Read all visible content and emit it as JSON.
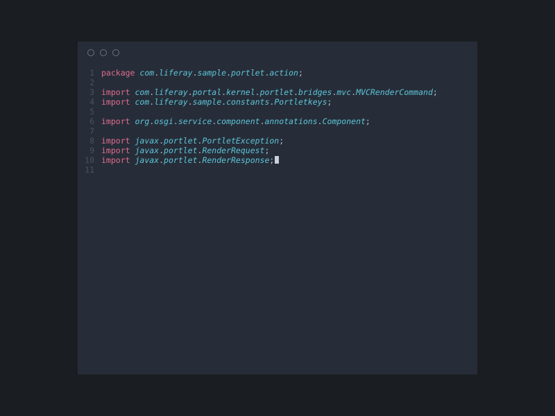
{
  "editor": {
    "lines": [
      {
        "num": "1",
        "tokens": [
          {
            "t": "kw",
            "v": "package"
          },
          {
            "t": "sp",
            "v": " "
          },
          {
            "t": "pkg",
            "v": "com"
          },
          {
            "t": "punct",
            "v": "."
          },
          {
            "t": "pkg",
            "v": "liferay"
          },
          {
            "t": "punct",
            "v": "."
          },
          {
            "t": "pkg",
            "v": "sample"
          },
          {
            "t": "punct",
            "v": "."
          },
          {
            "t": "pkg",
            "v": "portlet"
          },
          {
            "t": "punct",
            "v": "."
          },
          {
            "t": "pkg",
            "v": "action"
          },
          {
            "t": "punct",
            "v": ";"
          }
        ]
      },
      {
        "num": "2",
        "tokens": []
      },
      {
        "num": "3",
        "tokens": [
          {
            "t": "kw",
            "v": "import"
          },
          {
            "t": "sp",
            "v": " "
          },
          {
            "t": "pkg",
            "v": "com"
          },
          {
            "t": "punct",
            "v": "."
          },
          {
            "t": "pkg",
            "v": "liferay"
          },
          {
            "t": "punct",
            "v": "."
          },
          {
            "t": "pkg",
            "v": "portal"
          },
          {
            "t": "punct",
            "v": "."
          },
          {
            "t": "pkg",
            "v": "kernel"
          },
          {
            "t": "punct",
            "v": "."
          },
          {
            "t": "pkg",
            "v": "portlet"
          },
          {
            "t": "punct",
            "v": "."
          },
          {
            "t": "pkg",
            "v": "bridges"
          },
          {
            "t": "punct",
            "v": "."
          },
          {
            "t": "pkg",
            "v": "mvc"
          },
          {
            "t": "punct",
            "v": "."
          },
          {
            "t": "pkg",
            "v": "MVCRenderCommand"
          },
          {
            "t": "punct",
            "v": ";"
          }
        ]
      },
      {
        "num": "4",
        "tokens": [
          {
            "t": "kw",
            "v": "import"
          },
          {
            "t": "sp",
            "v": " "
          },
          {
            "t": "pkg",
            "v": "com"
          },
          {
            "t": "punct",
            "v": "."
          },
          {
            "t": "pkg",
            "v": "liferay"
          },
          {
            "t": "punct",
            "v": "."
          },
          {
            "t": "pkg",
            "v": "sample"
          },
          {
            "t": "punct",
            "v": "."
          },
          {
            "t": "pkg",
            "v": "constants"
          },
          {
            "t": "punct",
            "v": "."
          },
          {
            "t": "pkg",
            "v": "Portletkeys"
          },
          {
            "t": "punct",
            "v": ";"
          }
        ]
      },
      {
        "num": "5",
        "tokens": []
      },
      {
        "num": "6",
        "tokens": [
          {
            "t": "kw",
            "v": "import"
          },
          {
            "t": "sp",
            "v": " "
          },
          {
            "t": "pkg",
            "v": "org"
          },
          {
            "t": "punct",
            "v": "."
          },
          {
            "t": "pkg",
            "v": "osgi"
          },
          {
            "t": "punct",
            "v": "."
          },
          {
            "t": "pkg",
            "v": "service"
          },
          {
            "t": "punct",
            "v": "."
          },
          {
            "t": "pkg",
            "v": "component"
          },
          {
            "t": "punct",
            "v": "."
          },
          {
            "t": "pkg",
            "v": "annotations"
          },
          {
            "t": "punct",
            "v": "."
          },
          {
            "t": "pkg",
            "v": "Component"
          },
          {
            "t": "punct",
            "v": ";"
          }
        ]
      },
      {
        "num": "7",
        "tokens": []
      },
      {
        "num": "8",
        "tokens": [
          {
            "t": "kw",
            "v": "import"
          },
          {
            "t": "sp",
            "v": " "
          },
          {
            "t": "pkg",
            "v": "javax"
          },
          {
            "t": "punct",
            "v": "."
          },
          {
            "t": "pkg",
            "v": "portlet"
          },
          {
            "t": "punct",
            "v": "."
          },
          {
            "t": "pkg",
            "v": "PortletException"
          },
          {
            "t": "punct",
            "v": ";"
          }
        ]
      },
      {
        "num": "9",
        "tokens": [
          {
            "t": "kw",
            "v": "import"
          },
          {
            "t": "sp",
            "v": " "
          },
          {
            "t": "pkg",
            "v": "javax"
          },
          {
            "t": "punct",
            "v": "."
          },
          {
            "t": "pkg",
            "v": "portlet"
          },
          {
            "t": "punct",
            "v": "."
          },
          {
            "t": "pkg",
            "v": "RenderRequest"
          },
          {
            "t": "punct",
            "v": ";"
          }
        ]
      },
      {
        "num": "10",
        "tokens": [
          {
            "t": "kw",
            "v": "import"
          },
          {
            "t": "sp",
            "v": " "
          },
          {
            "t": "pkg",
            "v": "javax"
          },
          {
            "t": "punct",
            "v": "."
          },
          {
            "t": "pkg",
            "v": "portlet"
          },
          {
            "t": "punct",
            "v": "."
          },
          {
            "t": "pkg",
            "v": "RenderResponse"
          },
          {
            "t": "punct",
            "v": ";"
          },
          {
            "t": "cursor",
            "v": ""
          }
        ]
      },
      {
        "num": "11",
        "tokens": []
      }
    ]
  }
}
